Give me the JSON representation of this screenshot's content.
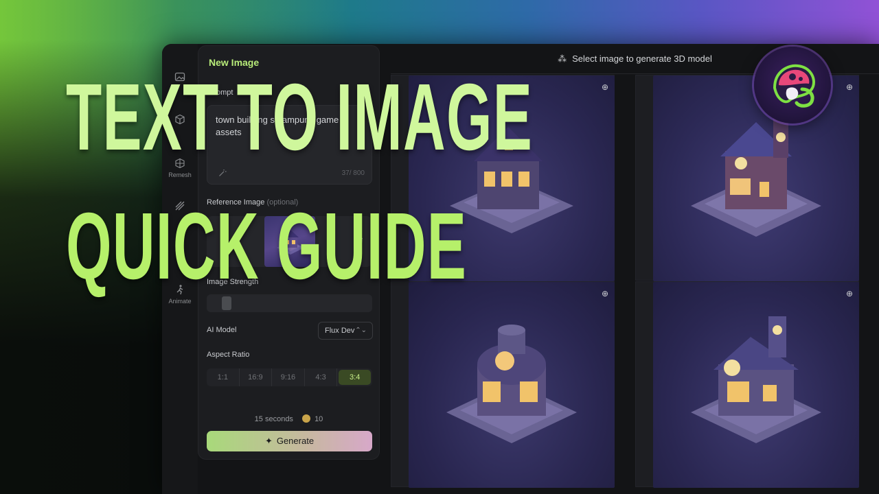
{
  "headline": {
    "line1": "TEXT TO IMAGE",
    "line2": "QUICK GUIDE"
  },
  "rail": [
    {
      "label": "",
      "icon": "image-icon"
    },
    {
      "label": "",
      "icon": "cube-icon"
    },
    {
      "label": "Remesh",
      "icon": "remesh-icon"
    },
    {
      "label": "",
      "icon": "texture-icon"
    },
    {
      "label": "",
      "icon": "stylize-icon"
    },
    {
      "label": "Animate",
      "icon": "animate-icon"
    }
  ],
  "panel": {
    "title": "New Image",
    "prompt_label": "Prompt",
    "prompt_text": "town building steampunk game assets",
    "prompt_counter": "37/ 800",
    "reference_label": "Reference Image",
    "reference_optional": "(optional)",
    "strength_label": "Image Strength",
    "model_label": "AI Model",
    "model_value": "Flux Dev",
    "aspect_label": "Aspect Ratio",
    "aspect_options": [
      "1:1",
      "16:9",
      "9:16",
      "4:3",
      "3:4"
    ],
    "aspect_selected": "3:4",
    "time": "15 seconds",
    "credits": "10",
    "generate_label": "Generate"
  },
  "gallery": {
    "title": "Select image to generate 3D model",
    "images": [
      {
        "name": "house-1"
      },
      {
        "name": "house-2"
      },
      {
        "name": "house-3"
      },
      {
        "name": "house-4"
      }
    ]
  },
  "colors": {
    "accent": "#b8ec7a",
    "headline": "#cff79c",
    "panel_bg": "#1c1d20"
  }
}
